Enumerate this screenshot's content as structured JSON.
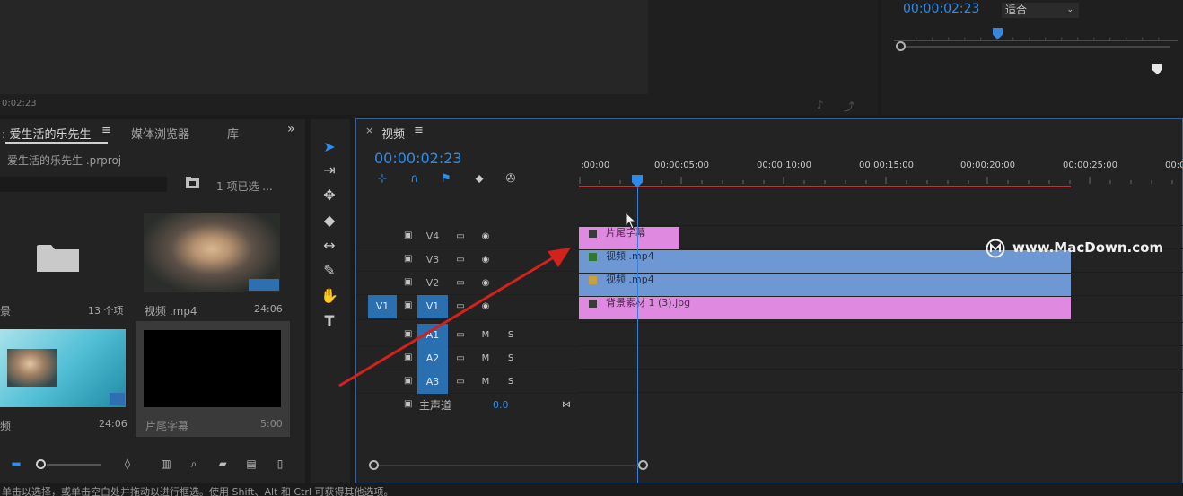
{
  "source_monitor": {
    "timecode": "0:02:23"
  },
  "program_monitor": {
    "timecode": "00:00:02:23",
    "fit_select": "适合"
  },
  "project_panel": {
    "tabs": [
      {
        "label": ": 爱生活的乐先生"
      },
      {
        "label": "媒体浏览器"
      },
      {
        "label": "库"
      }
    ],
    "more": "»",
    "file_name": "爱生活的乐先生 .prproj",
    "selection_count": "1 项已选 ...",
    "items": [
      {
        "label": "景",
        "meta": "13 个项"
      },
      {
        "label": "视频 .mp4",
        "meta": "24:06"
      },
      {
        "label": "频",
        "meta": "24:06"
      },
      {
        "label": "片尾字幕",
        "meta": "5:00"
      }
    ]
  },
  "timeline": {
    "title": "视频",
    "menu": "≡",
    "close": "×",
    "timecode": "00:00:02:23",
    "ruler_labels": [
      ":00:00",
      "00:00:05:00",
      "00:00:10:00",
      "00:00:15:00",
      "00:00:20:00",
      "00:00:25:00",
      "00:0"
    ],
    "tracks": [
      {
        "name": "V4",
        "type": "video",
        "active": false
      },
      {
        "name": "V3",
        "type": "video",
        "active": false
      },
      {
        "name": "V2",
        "type": "video",
        "active": false
      },
      {
        "name": "V1",
        "type": "video",
        "active": true,
        "source": "V1"
      },
      {
        "name": "A1",
        "type": "audio",
        "active": true,
        "m": "M",
        "s": "S"
      },
      {
        "name": "A2",
        "type": "audio",
        "active": true,
        "m": "M",
        "s": "S"
      },
      {
        "name": "A3",
        "type": "audio",
        "active": true,
        "m": "M",
        "s": "S"
      }
    ],
    "master": {
      "label": "主声道",
      "value": "0.0"
    },
    "clips": [
      {
        "track": "V4",
        "label": "片尾字幕",
        "color": "#e089e0",
        "start": 0,
        "end": 5
      },
      {
        "track": "V3",
        "label": "视频 .mp4",
        "color": "#6e98d3",
        "start": 0,
        "end": 24.07
      },
      {
        "track": "V2",
        "label": "视频 .mp4",
        "color": "#6e98d3",
        "start": 0,
        "end": 24.07
      },
      {
        "track": "V1",
        "label": "背景素材 1 (3).jpg",
        "color": "#e089e0",
        "start": 0,
        "end": 24.07
      }
    ]
  },
  "watermark": {
    "text": "www.MacDown.com"
  },
  "status_bar": {
    "text": "单击以选择，或单击空白处并拖动以进行框选。使用 Shift、Alt 和 Ctrl 可获得其他选项。"
  },
  "colors": {
    "accent": "#2d8ceb",
    "track_active": "#2a6fb0",
    "clip_pink": "#e089e0",
    "clip_blue": "#6e98d3",
    "work_area": "#c0352e",
    "annotation_arrow": "#d3211b"
  }
}
